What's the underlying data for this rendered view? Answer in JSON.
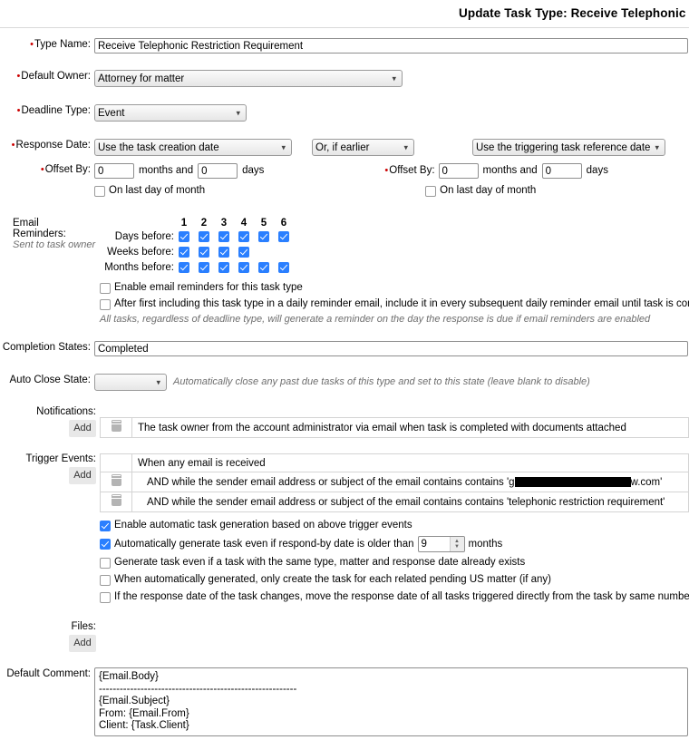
{
  "header": {
    "title": "Update Task Type: Receive Telephonic R"
  },
  "fields": {
    "type_name": {
      "label": "Type Name:",
      "required": true,
      "value": "Receive Telephonic Restriction Requirement"
    },
    "default_owner": {
      "label": "Default Owner:",
      "required": true,
      "value": "Attorney for matter"
    },
    "deadline_type": {
      "label": "Deadline Type:",
      "required": true,
      "value": "Event"
    },
    "response_date": {
      "label": "Response Date:",
      "required": true,
      "primary_value": "Use the task creation date",
      "comparator_value": "Or, if earlier",
      "secondary_value": "Use the triggering task reference date"
    },
    "offset_left": {
      "label": "Offset By:",
      "required": true,
      "months": "0",
      "months_suffix": "months and",
      "days": "0",
      "days_suffix": "days",
      "last_day_label": "On last day of month",
      "last_day_checked": false
    },
    "offset_right": {
      "label": "Offset By:",
      "required": true,
      "months": "0",
      "months_suffix": "months and",
      "days": "0",
      "days_suffix": "days",
      "last_day_label": "On last day of month",
      "last_day_checked": false
    },
    "completion_states": {
      "label": "Completion States:",
      "value": "Completed"
    },
    "auto_close_state": {
      "label": "Auto Close State:",
      "value": "",
      "hint": "Automatically close any past due tasks of this type and set to this state (leave blank to disable)"
    },
    "default_comment": {
      "label": "Default Comment:",
      "value": "{Email.Body}\n---------------------------------------------------------\n{Email.Subject}\nFrom: {Email.From}\nClient: {Task.Client}"
    }
  },
  "email_reminders": {
    "label": "Email Reminders:",
    "sublabel": "Sent to task owner",
    "column_numbers": [
      "1",
      "2",
      "3",
      "4",
      "5",
      "6"
    ],
    "rows": [
      {
        "label": "Days before:",
        "checks": [
          true,
          true,
          true,
          true,
          true,
          true
        ]
      },
      {
        "label": "Weeks before:",
        "checks": [
          true,
          true,
          true,
          true,
          false,
          false
        ]
      },
      {
        "label": "Months before:",
        "checks": [
          true,
          true,
          true,
          true,
          true,
          true
        ]
      }
    ],
    "options": [
      {
        "label": "Enable email reminders for this task type",
        "checked": false
      },
      {
        "label": "After first including this task type in a daily reminder email, include it in every subsequent daily reminder email until task is complete",
        "checked": false
      }
    ],
    "note": "All tasks, regardless of deadline type, will generate a reminder on the day the response is due if email reminders are enabled"
  },
  "notifications": {
    "label": "Notifications:",
    "add_label": "Add",
    "rows": [
      {
        "text": "The task owner from the account administrator via email when task is completed with documents attached",
        "has_delete": true
      }
    ]
  },
  "trigger_events": {
    "label": "Trigger Events:",
    "add_label": "Add",
    "rows": [
      {
        "text": "When any email is received",
        "has_delete": false,
        "indent": false
      },
      {
        "prefix": "AND while the sender email address or subject of the email contains contains 'g",
        "redacted": true,
        "suffix": "w.com'",
        "has_delete": true,
        "indent": true
      },
      {
        "text": "AND while the sender email address or subject of the email contains contains 'telephonic restriction requirement'",
        "has_delete": true,
        "indent": true
      }
    ],
    "options": [
      {
        "label": "Enable automatic task generation based on above trigger events",
        "checked": true,
        "type": "plain"
      },
      {
        "label_before": "Automatically generate task even if respond-by date is older than",
        "stepper_value": "9",
        "label_after": "months",
        "checked": true,
        "type": "stepper"
      },
      {
        "label": "Generate task even if a task with the same type, matter and response date already exists",
        "checked": false,
        "type": "plain"
      },
      {
        "label": "When automatically generated, only create the task for each related pending US matter (if any)",
        "checked": false,
        "type": "plain"
      },
      {
        "label": "If the response date of the task changes, move the response date of all tasks triggered directly from the task by same number of calen",
        "checked": false,
        "type": "plain"
      }
    ]
  },
  "files": {
    "label": "Files:",
    "add_label": "Add"
  },
  "colors": {
    "checkbox_on": "#2a7fff",
    "required_marker": "#cc0000",
    "hint_text": "#6e6e6e",
    "border": "#8e8e8e"
  }
}
